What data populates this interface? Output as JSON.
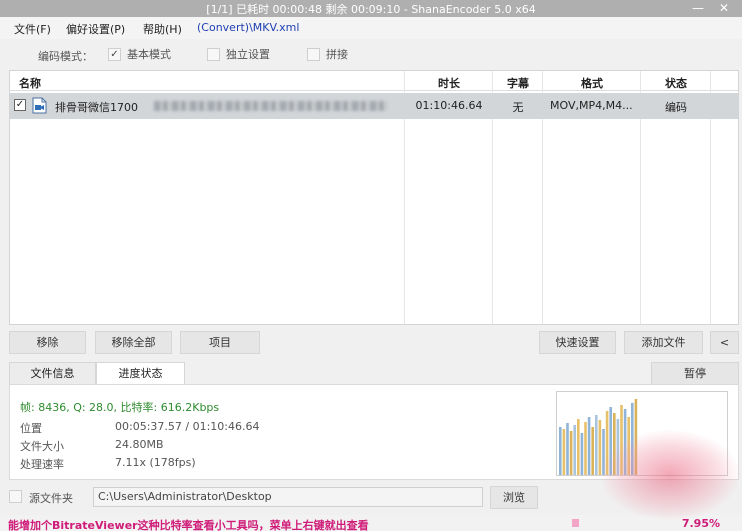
{
  "window": {
    "title": "[1/1] 已耗时 00:00:48  剩余 00:09:10 - ShanaEncoder 5.0 x64",
    "minimize": "—",
    "close": "✕"
  },
  "menu": {
    "file": "文件(F)",
    "preferences": "偏好设置(P)",
    "help": "帮助(H)",
    "config": "(Convert)\\MKV.xml"
  },
  "mode": {
    "label": "编码模式：",
    "basic_label": "基本模式",
    "basic_checked": true,
    "independent_label": "独立设置",
    "independent_checked": false,
    "concat_label": "拼接",
    "concat_checked": false
  },
  "list": {
    "columns": [
      "名称",
      "时长",
      "字幕",
      "格式",
      "状态"
    ],
    "rows": [
      {
        "checked": true,
        "name": "排骨哥微信1700",
        "duration": "01:10:46.64",
        "subtitle": "无",
        "format": "MOV,MP4,M4...",
        "status": "编码"
      }
    ]
  },
  "buttons": {
    "remove": "移除",
    "remove_all": "移除全部",
    "item": "项目",
    "quick_settings": "快速设置",
    "add_file": "添加文件",
    "collapse": "<",
    "pause": "暂停",
    "browse": "浏览"
  },
  "tabs": {
    "file_info": "文件信息",
    "progress": "进度状态"
  },
  "progress": {
    "stats": "帧: 8436, Q: 28.0, 比特率: 616.2Kbps",
    "position_label": "位置",
    "position_value": "00:05:37.57 / 01:10:46.64",
    "file_size_label": "文件大小",
    "file_size_value": "24.80MB",
    "speed_label": "处理速率",
    "speed_value": "7.11x (178fps)"
  },
  "source": {
    "checked": false,
    "label": "源文件夹",
    "path": "C:\\Users\\Administrator\\Desktop"
  },
  "status": {
    "message": "能增加个BitrateViewer这种比特率查看小工具吗，菜单上右键就出查看",
    "percent_text": "7.95%",
    "percent_value": 7.95
  },
  "colors": {
    "accent_green": "#2e8b2e",
    "status_magenta": "#d01c79",
    "title_bar": "#afafaf"
  }
}
